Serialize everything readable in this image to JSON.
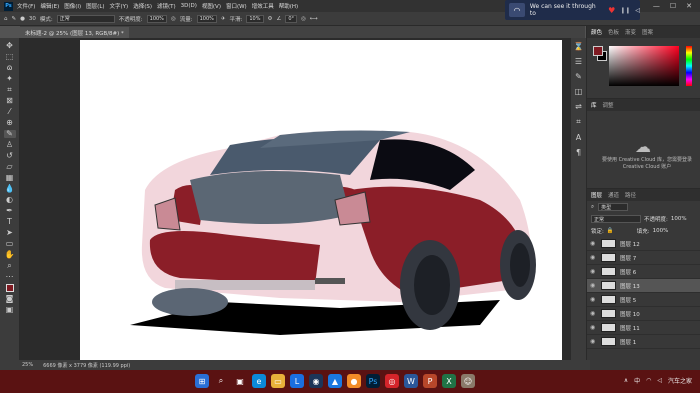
{
  "app": {
    "logo": "Ps"
  },
  "menu": [
    "文件(F)",
    "编辑(E)",
    "图像(I)",
    "图层(L)",
    "文字(Y)",
    "选择(S)",
    "滤镜(T)",
    "3D(D)",
    "视图(V)",
    "窗口(W)",
    "增效工具",
    "帮助(H)"
  ],
  "notification": {
    "text": "We can see it through to"
  },
  "options": {
    "size": "30",
    "mode_label": "模式:",
    "mode_value": "正常",
    "opacity_label": "不透明度:",
    "opacity_value": "100%",
    "flow_label": "流量:",
    "flow_value": "100%",
    "smooth_label": "平滑:",
    "smooth_value": "10%",
    "angle_value": "0°"
  },
  "document": {
    "tab_title": "未标题-2 @ 25% (图层 13, RGB/8#) *"
  },
  "status": {
    "zoom": "25%",
    "size": "6669 像素 x 3779 像素 (119.99 ppi)"
  },
  "panels": {
    "color_tabs": [
      "颜色",
      "色板",
      "渐变",
      "图案"
    ],
    "lib_tabs": [
      "库",
      "调整"
    ],
    "lib_text": "要使用 Creative Cloud 库，您需要登录 Creative Cloud 账户",
    "layer_tabs": [
      "图层",
      "通道",
      "路径"
    ],
    "layer_filter": "类型",
    "blend_mode": "正常",
    "opacity_label": "不透明度:",
    "opacity_value": "100%",
    "lock_label": "锁定:",
    "fill_label": "填充:",
    "fill_value": "100%",
    "layers": [
      {
        "name": "图层 12"
      },
      {
        "name": "图层 7"
      },
      {
        "name": "图层 6"
      },
      {
        "name": "图层 13",
        "selected": true
      },
      {
        "name": "图层 5"
      },
      {
        "name": "图层 10"
      },
      {
        "name": "图层 11"
      },
      {
        "name": "图层 1"
      }
    ]
  },
  "colors": {
    "foreground": "#7f1a22",
    "background": "#000000"
  },
  "taskbar": {
    "time": "中"
  },
  "watermark": "汽车之家"
}
